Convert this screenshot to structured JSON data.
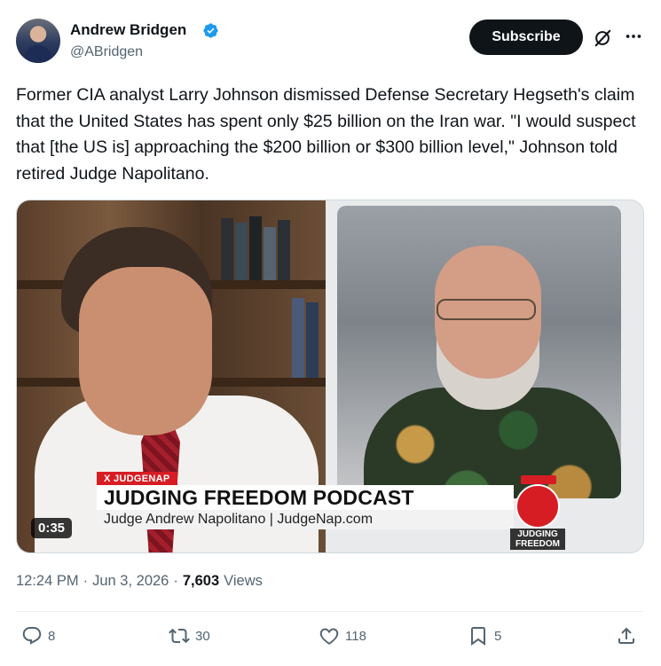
{
  "author": {
    "name": "Andrew Bridgen",
    "handle": "@ABridgen",
    "verified_color": "#1d9bf0"
  },
  "header": {
    "subscribe_label": "Subscribe",
    "icons": [
      "grok-icon",
      "more-icon"
    ]
  },
  "tweet": {
    "text": "Former CIA analyst Larry Johnson dismissed Defense Secretary Hegseth's claim that the United States has spent only $25 billion on the Iran war. \"I would suspect that [the US is] approaching the $200 billion or $300 billion level,\" Johnson told retired Judge Napolitano."
  },
  "video": {
    "source_tag": "X JUDGENAP",
    "title": "JUDGING FREEDOM PODCAST",
    "subtitle": "Judge Andrew Napolitano | JudgeNap.com",
    "logo_text": "JUDGING FREEDOM",
    "duration": "0:35",
    "accent_color": "#d71d24"
  },
  "meta": {
    "time": "12:24 PM",
    "separator": "·",
    "date": "Jun 3, 2026",
    "views_count": "7,603",
    "views_label": "Views"
  },
  "actions": {
    "replies": "8",
    "reposts": "30",
    "likes": "118",
    "bookmarks": "5"
  }
}
